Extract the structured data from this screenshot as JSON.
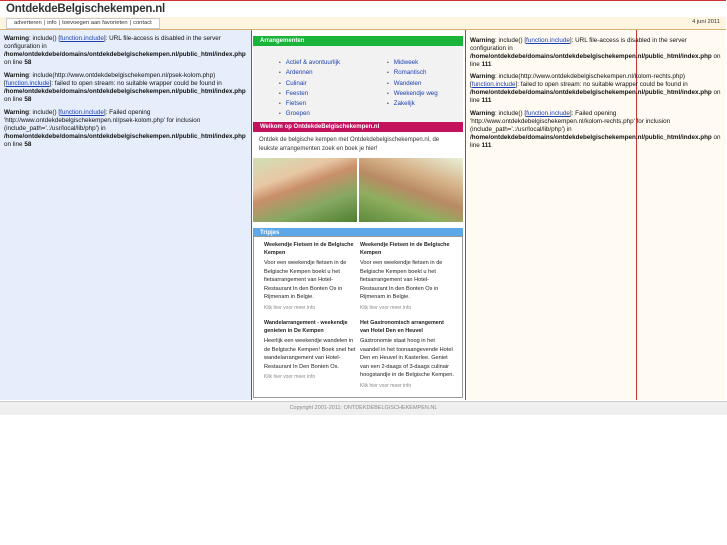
{
  "site": {
    "title": "OntdekdeBelgischekempen.nl",
    "date": "4 juni 2011"
  },
  "nav": {
    "links": [
      "adverteren",
      "info",
      "toevoegen aan favorieten",
      "contact"
    ],
    "separator": "|"
  },
  "left_warnings": [
    {
      "label": "Warning",
      "pre": ": include() [",
      "func": "function.include",
      "post": "]: URL file-access is disabled in the server configuration in ",
      "path": "/home/ontdekdebe/domains/ontdekdebelgischekempen.nl/public_html/index.php",
      "online": " on line ",
      "line": "58"
    },
    {
      "label": "Warning",
      "pre": ": include(http://www.ontdekdebelgischekempen.nl/psek-kolom.php) [",
      "func": "function.include",
      "post": "]: failed to open stream: no suitable wrapper could be found in ",
      "path": "/home/ontdekdebe/domains/ontdekdebelgischekempen.nl/public_html/index.php",
      "online": " on line ",
      "line": "58"
    },
    {
      "label": "Warning",
      "pre": ": include() [",
      "func": "function.include",
      "post": "]: Failed opening 'http://www.ontdekdebelgischekempen.nl/psek-kolom.php' for inclusion (include_path='.:/usr/local/lib/php') in ",
      "path": "/home/ontdekdebe/domains/ontdekdebelgischekempen.nl/public_html/index.php",
      "online": " on line ",
      "line": "58"
    }
  ],
  "right_warnings": [
    {
      "label": "Warning",
      "pre": ": include() [",
      "func": "function.include",
      "post": "]: URL file-access is disabled in the server configuration in ",
      "path": "/home/ontdekdebe/domains/ontdekdebelgischekempen.nl/public_html/index.php",
      "online": " on line ",
      "line": "111"
    },
    {
      "label": "Warning",
      "pre": ": include(http://www.ontdekdebelgischekempen.nl/kolom-rechts.php) [",
      "func": "function.include",
      "post": "]: failed to open stream: no suitable wrapper could be found in ",
      "path": "/home/ontdekdebe/domains/ontdekdebelgischekempen.nl/public_html/index.php",
      "online": " on line ",
      "line": "111"
    },
    {
      "label": "Warning",
      "pre": ": include() [",
      "func": "function.include",
      "post": "]: Failed opening 'http://www.ontdekdebelgischekempen.nl/kolom-rechts.php' for inclusion (include_path='.:/usr/local/lib/php') in ",
      "path": "/home/ontdekdebe/domains/ontdekdebelgischekempen.nl/public_html/index.php",
      "online": " on line ",
      "line": "111"
    }
  ],
  "arrangementen": {
    "heading": "Arrangementen",
    "left": [
      "Actief & avontuurlijk",
      "Ardennen",
      "Culinair",
      "Feesten",
      "Fietsen",
      "Groepen"
    ],
    "right": [
      "Midweek",
      "Romantisch",
      "Wandelen",
      "Weekendje weg",
      "Zakelijk"
    ]
  },
  "welcome": {
    "heading": "Welkom op OntdekdeBelgischekempen.nl",
    "text": "Ontdek de belgische kempen met Ontdekdebelgischekempen.nl, de leukste arrangementen zoek en boek je hier!"
  },
  "tripjes": {
    "heading": "Tripjes",
    "items": [
      {
        "title": "Weekendje Fietsen in de Belgische Kempen",
        "text": "Voor een weekendje fietsen in de Belgische Kempen boekt u het fietsarrangement van Hotel-Restaurant In den Bonten Os in Rijmenam in Belgie.",
        "link": "Klik hier voor meer info"
      },
      {
        "title": "Weekendje Fietsen in de Belgische Kempen",
        "text": "Voor een weekendje fietsen in de Belgische Kempen boekt u het fietsarrangement van Hotel-Restaurant In den Bonten Os in Rijmenam in Belgie.",
        "link": "Klik hier voor meer info"
      },
      {
        "title": "Wandelarrangement - weekendje genieten in De Kempen",
        "text": "Heerlijk een weekendje wandelen in de Belgische Kempen! Boek snel het wandelarrangement van Hotel-Restaurant In Den Bonten Os.",
        "link": "Klik hier voor meer info"
      },
      {
        "title": "Het Gastronomisch arrangement van Hotel Den en Heuvel",
        "text": "Gastronomie staat hoog in het vaandel in het toonaangevende Hotel Den en Heuvel in Kasterlee. Geniet van een 2-daags of 3-daags culinair hoogstandje in de Belgische Kempen.",
        "link": "Klik hier voor meer info"
      }
    ]
  },
  "footer": {
    "text": "Copyright 2001-2011: ONTDEKDEBELGISCHEKEMPEN.NL"
  },
  "colors": {
    "green": "#19b53a",
    "magenta": "#c4115e",
    "blue": "#5da7e8",
    "link": "#1a3fb0"
  }
}
